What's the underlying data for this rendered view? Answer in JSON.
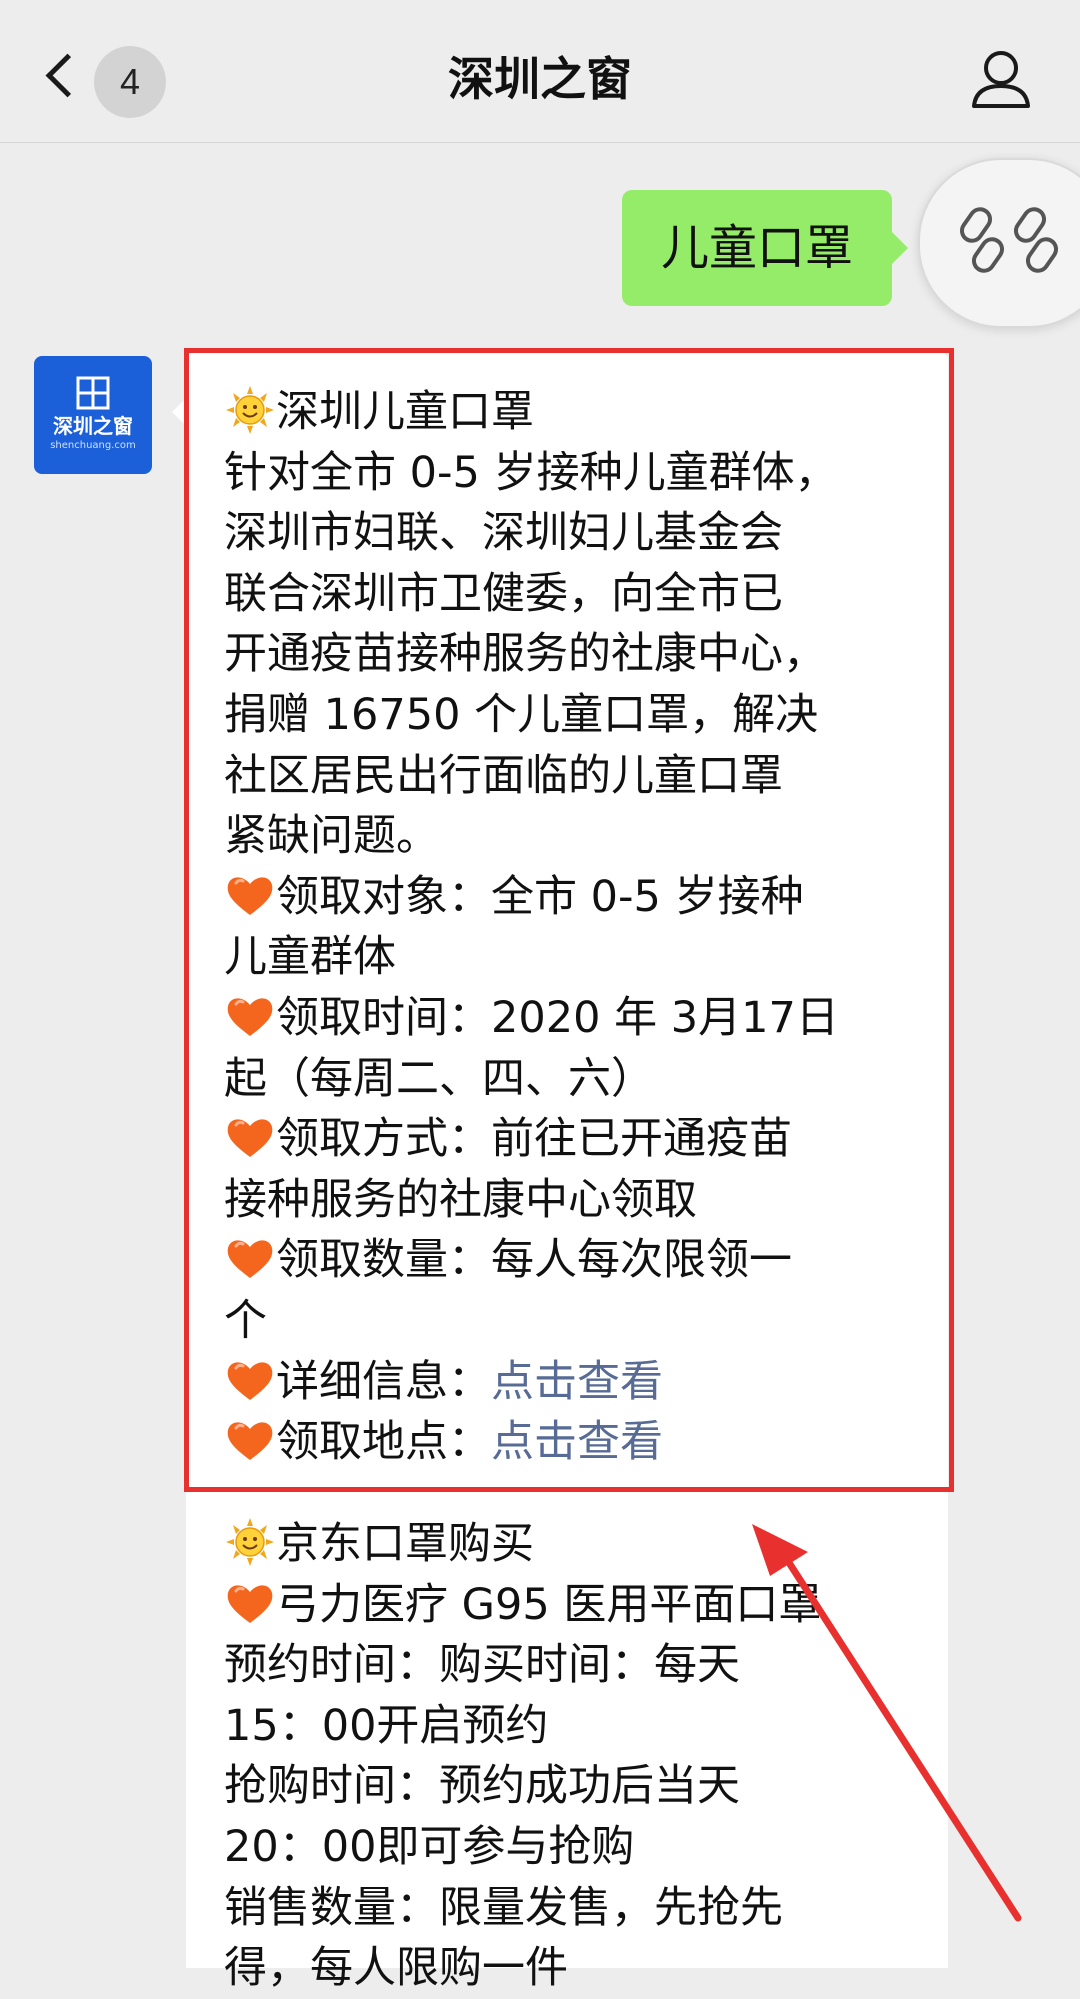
{
  "header": {
    "back_count": "4",
    "title": "深圳之窗"
  },
  "chat": {
    "sent_message": "儿童口罩"
  },
  "avatar": {
    "logo_text": "深圳之窗",
    "logo_sub": "shenchuang.com"
  },
  "card1": {
    "title": "深圳儿童口罩",
    "intro": [
      "针对全市 0-5 岁接种儿童群体，",
      "深圳市妇联、深圳妇儿基金会",
      "联合深圳市卫健委，向全市已",
      "开通疫苗接种服务的社康中心，",
      "捐赠 16750 个儿童口罩，解决",
      "社区居民出行面临的儿童口罩",
      "紧缺问题。"
    ],
    "target_label": "领取对象：",
    "target_value_line1": "全市 0-5 岁接种",
    "target_value_line2": "儿童群体",
    "time_label": "领取时间：",
    "time_value_line1": "2020 年 3月17日",
    "time_value_line2": "起（每周二、四、六）",
    "method_label": "领取方式：",
    "method_value_line1": "前往已开通疫苗",
    "method_value_line2": "接种服务的社康中心领取",
    "quantity_label": "领取数量：",
    "quantity_value_line1": "每人每次限领一",
    "quantity_value_line2": "个",
    "detail_label": "详细信息：",
    "detail_link": "点击查看",
    "location_label": "领取地点：",
    "location_link": "点击查看"
  },
  "card2": {
    "title": "京东口罩购买",
    "product": "弓力医疗 G95 医用平面口罩",
    "reserve_line1": "预约时间：购买时间：每天",
    "reserve_line2": "15：00开启预约",
    "rush_line1": "抢购时间：预约成功后当天",
    "rush_line2": "20：00即可参与抢购",
    "sales_line1": "销售数量：限量发售，先抢先",
    "sales_line2": "得，每人限购一件"
  },
  "colors": {
    "link": "#576b95",
    "sent_bubble": "#95ec69",
    "highlight": "#e8312f",
    "avatar": "#1b5fd9"
  },
  "icons": {
    "sun": "sun-face-icon",
    "heart": "heart-icon",
    "user": "user-icon",
    "back": "chevron-left-icon",
    "link": "link-icon"
  }
}
